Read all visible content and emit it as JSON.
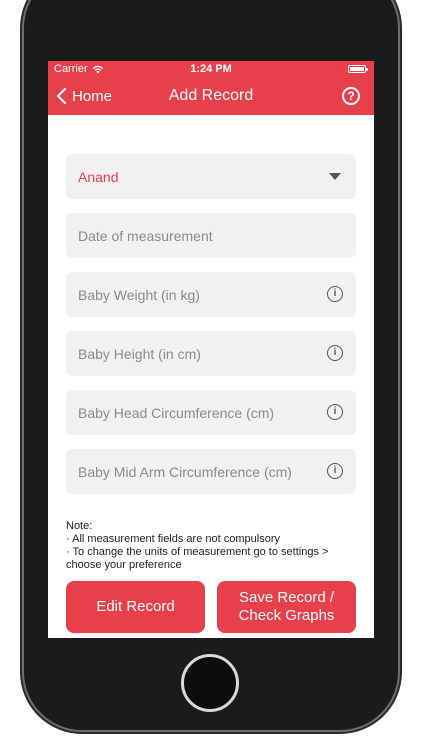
{
  "status_bar": {
    "carrier": "Carrier",
    "time": "1:24 PM"
  },
  "nav": {
    "back_label": "Home",
    "title": "Add Record",
    "help_symbol": "?"
  },
  "form": {
    "baby_select": "Anand",
    "date_placeholder": "Date of measurement",
    "weight_placeholder": "Baby Weight (in kg)",
    "height_placeholder": "Baby Height (in cm)",
    "head_placeholder": "Baby Head Circumference (cm)",
    "arm_placeholder": "Baby Mid Arm Circumference (cm)",
    "info_symbol": "i"
  },
  "note": {
    "title": "Note:",
    "line1": "· All measurement fields are not compulsory",
    "line2": "· To change the units of measurement go to settings > choose your preference"
  },
  "buttons": {
    "edit": "Edit Record",
    "save_line1": "Save Record /",
    "save_line2": "Check Graphs"
  },
  "colors": {
    "accent": "#e7404a",
    "field_bg": "#f1f1f3"
  }
}
